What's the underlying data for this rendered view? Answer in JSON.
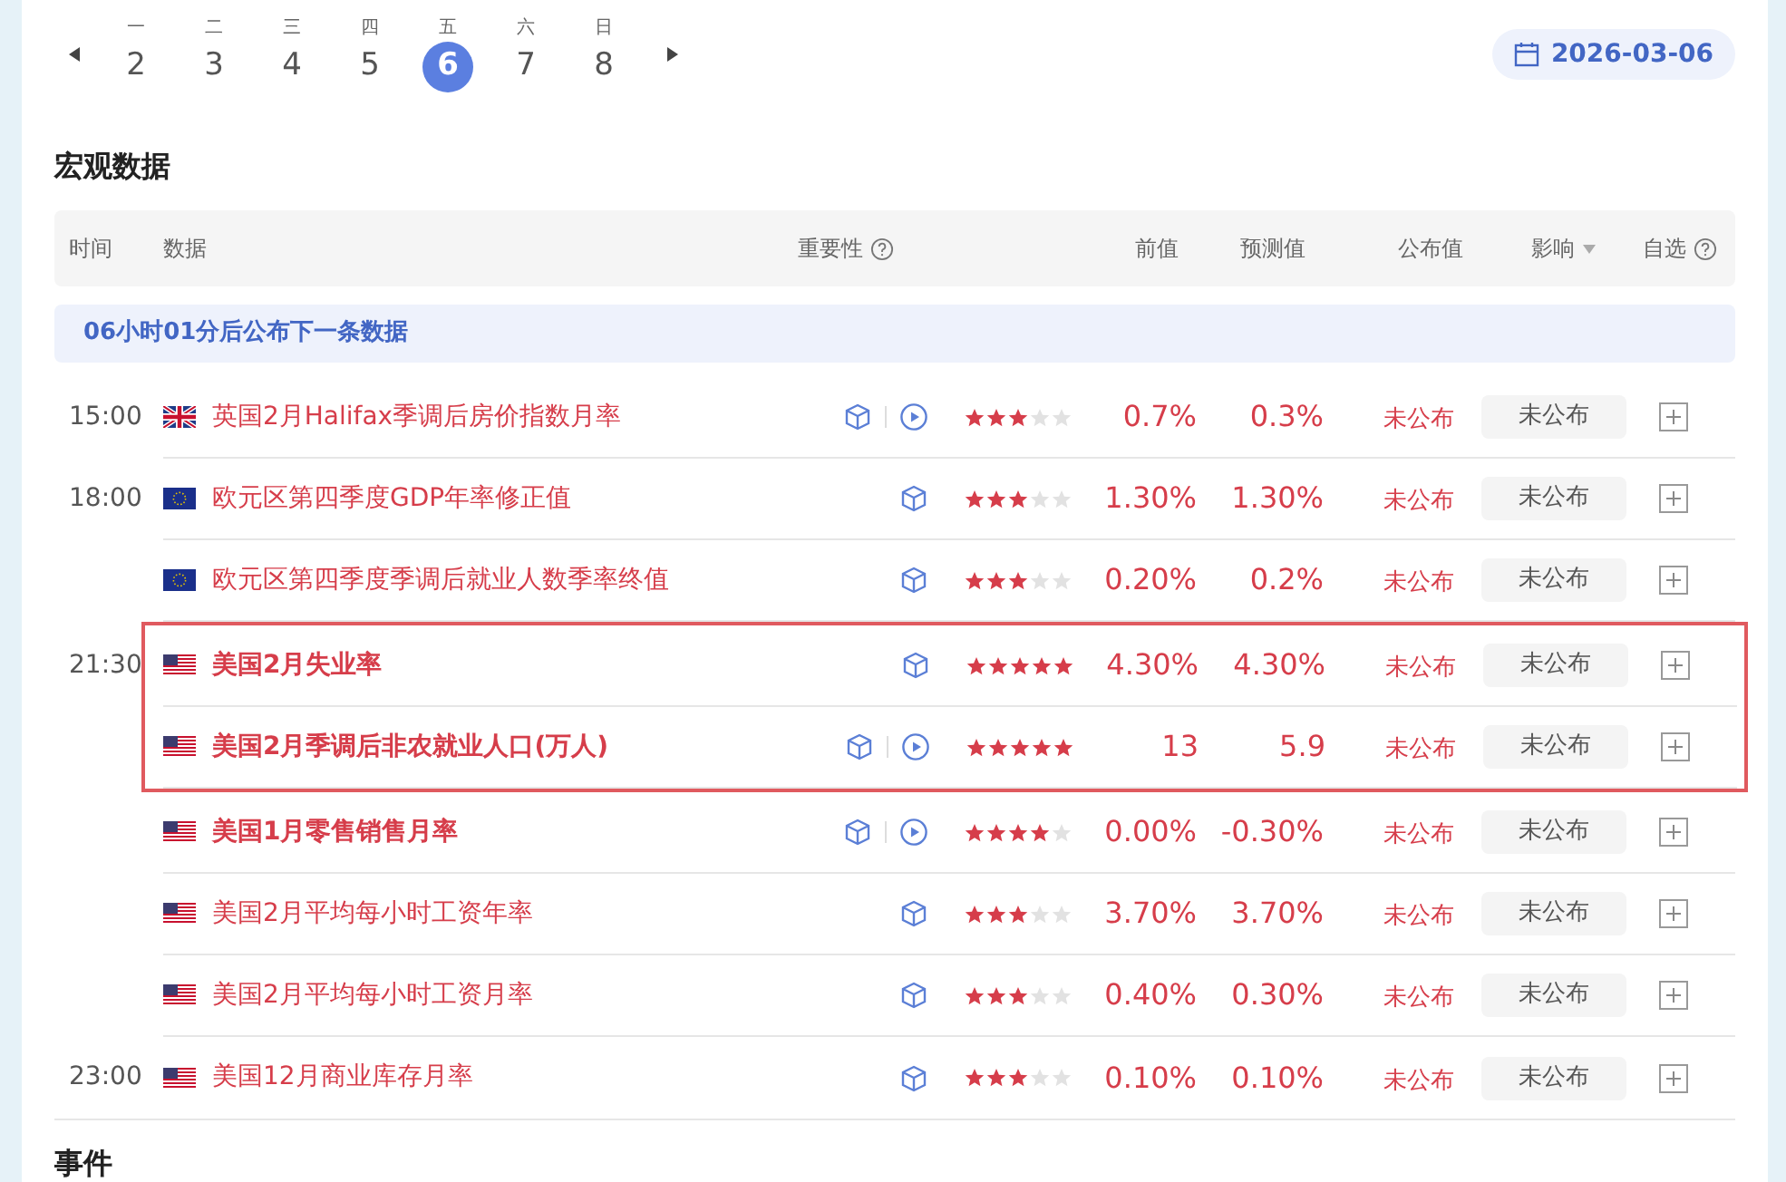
{
  "week": {
    "days": [
      {
        "weekday": "一",
        "date": "2",
        "selected": false
      },
      {
        "weekday": "二",
        "date": "3",
        "selected": false
      },
      {
        "weekday": "三",
        "date": "4",
        "selected": false
      },
      {
        "weekday": "四",
        "date": "5",
        "selected": false
      },
      {
        "weekday": "五",
        "date": "6",
        "selected": true
      },
      {
        "weekday": "六",
        "date": "7",
        "selected": false
      },
      {
        "weekday": "日",
        "date": "8",
        "selected": false
      }
    ],
    "date_button": "2026-03-06"
  },
  "section_title": "宏观数据",
  "table": {
    "columns": [
      {
        "label": "时间",
        "help": false,
        "sort": false
      },
      {
        "label": "数据",
        "help": false,
        "sort": false
      },
      {
        "label": "重要性",
        "help": true,
        "sort": false
      },
      {
        "label": "前值",
        "help": false,
        "sort": false
      },
      {
        "label": "预测值",
        "help": false,
        "sort": false
      },
      {
        "label": "公布值",
        "help": false,
        "sort": false
      },
      {
        "label": "影响",
        "help": false,
        "sort": true
      },
      {
        "label": "自选",
        "help": true,
        "sort": false
      }
    ],
    "notice": "06小时01分后公布下一条数据",
    "rows": [
      {
        "time": "15:00",
        "kind": "uk",
        "name": "英国2月Halifax季调后房价指数月率",
        "bold": false,
        "video": true,
        "highlighted": false,
        "stars": 3,
        "previous": "0.7%",
        "forecast": "0.3%",
        "actual": "未公布",
        "impact": "未公布"
      },
      {
        "time": "18:00",
        "kind": "eu",
        "name": "欧元区第四季度GDP年率修正值",
        "bold": false,
        "video": false,
        "highlighted": false,
        "stars": 3,
        "previous": "1.30%",
        "forecast": "1.30%",
        "actual": "未公布",
        "impact": "未公布"
      },
      {
        "kind": "eu",
        "name": "欧元区第四季度季调后就业人数季率终值",
        "bold": false,
        "video": false,
        "highlighted": false,
        "stars": 3,
        "previous": "0.20%",
        "forecast": "0.2%",
        "actual": "未公布",
        "impact": "未公布"
      },
      {
        "time": "21:30",
        "kind": "us",
        "name": "美国2月失业率",
        "bold": true,
        "video": false,
        "highlighted": true,
        "stars": 5,
        "previous": "4.30%",
        "forecast": "4.30%",
        "actual": "未公布",
        "impact": "未公布"
      },
      {
        "kind": "us",
        "name": "美国2月季调后非农就业人口(万人)",
        "bold": true,
        "video": true,
        "highlighted": true,
        "stars": 5,
        "previous": "13",
        "forecast": "5.9",
        "actual": "未公布",
        "impact": "未公布"
      },
      {
        "kind": "us",
        "name": "美国1月零售销售月率",
        "bold": true,
        "video": true,
        "highlighted": false,
        "stars": 4,
        "previous": "0.00%",
        "forecast": "-0.30%",
        "actual": "未公布",
        "impact": "未公布"
      },
      {
        "kind": "us",
        "name": "美国2月平均每小时工资年率",
        "bold": false,
        "video": false,
        "highlighted": false,
        "stars": 3,
        "previous": "3.70%",
        "forecast": "3.70%",
        "actual": "未公布",
        "impact": "未公布"
      },
      {
        "kind": "us",
        "name": "美国2月平均每小时工资月率",
        "bold": false,
        "video": false,
        "highlighted": false,
        "stars": 3,
        "previous": "0.40%",
        "forecast": "0.30%",
        "actual": "未公布",
        "impact": "未公布"
      },
      {
        "time": "23:00",
        "kind": "us",
        "name": "美国12月商业库存月率",
        "bold": false,
        "video": false,
        "highlighted": false,
        "stars": 3,
        "previous": "0.10%",
        "forecast": "0.10%",
        "actual": "未公布",
        "impact": "未公布"
      }
    ]
  },
  "events_title": "事件"
}
